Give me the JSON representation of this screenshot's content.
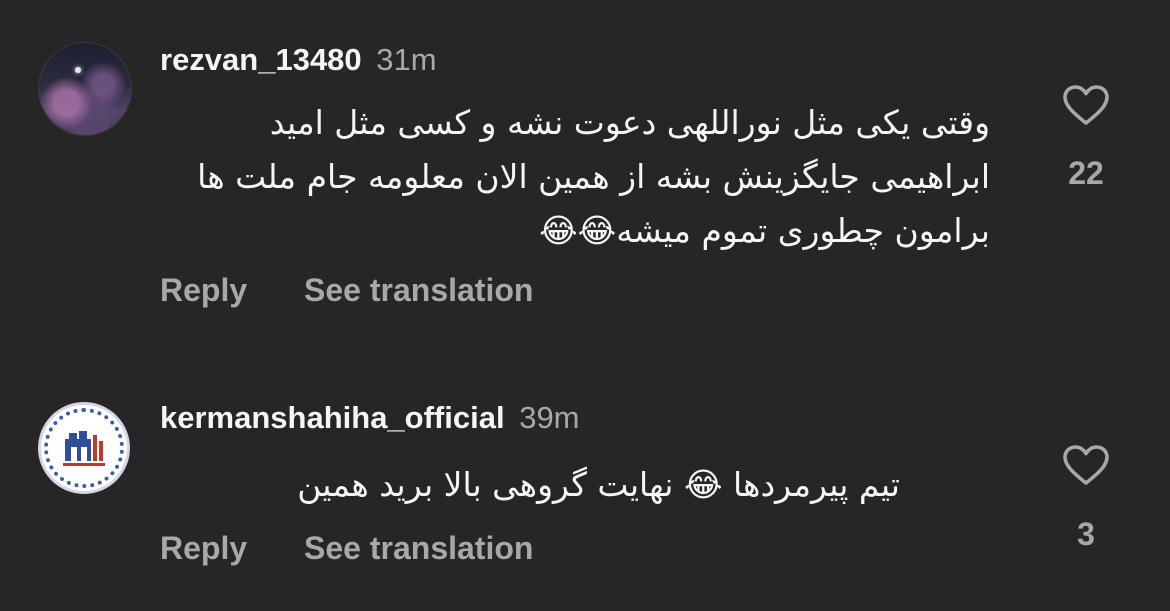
{
  "comments": [
    {
      "username": "rezvan_13480",
      "time": "31m",
      "text": "وقتی یکی مثل نوراللهی دعوت نشه و کسی مثل امید ابراهیمی جایگزینش بشه از همین الان معلومه جام ملت ها برامون چطوری تموم میشه😂😂",
      "reply_label": "Reply",
      "translate_label": "See translation",
      "likes": "22"
    },
    {
      "username": "kermanshahiha_official",
      "time": "39m",
      "text": "تیم پیرمردها 😂 نهایت گروهی بالا برید همین",
      "reply_label": "Reply",
      "translate_label": "See translation",
      "likes": "3"
    }
  ],
  "colors": {
    "background": "#262626",
    "primary_text": "#f5f5f5",
    "secondary_text": "#a8a8a8"
  },
  "icons": {
    "like": "heart-outline-icon"
  }
}
